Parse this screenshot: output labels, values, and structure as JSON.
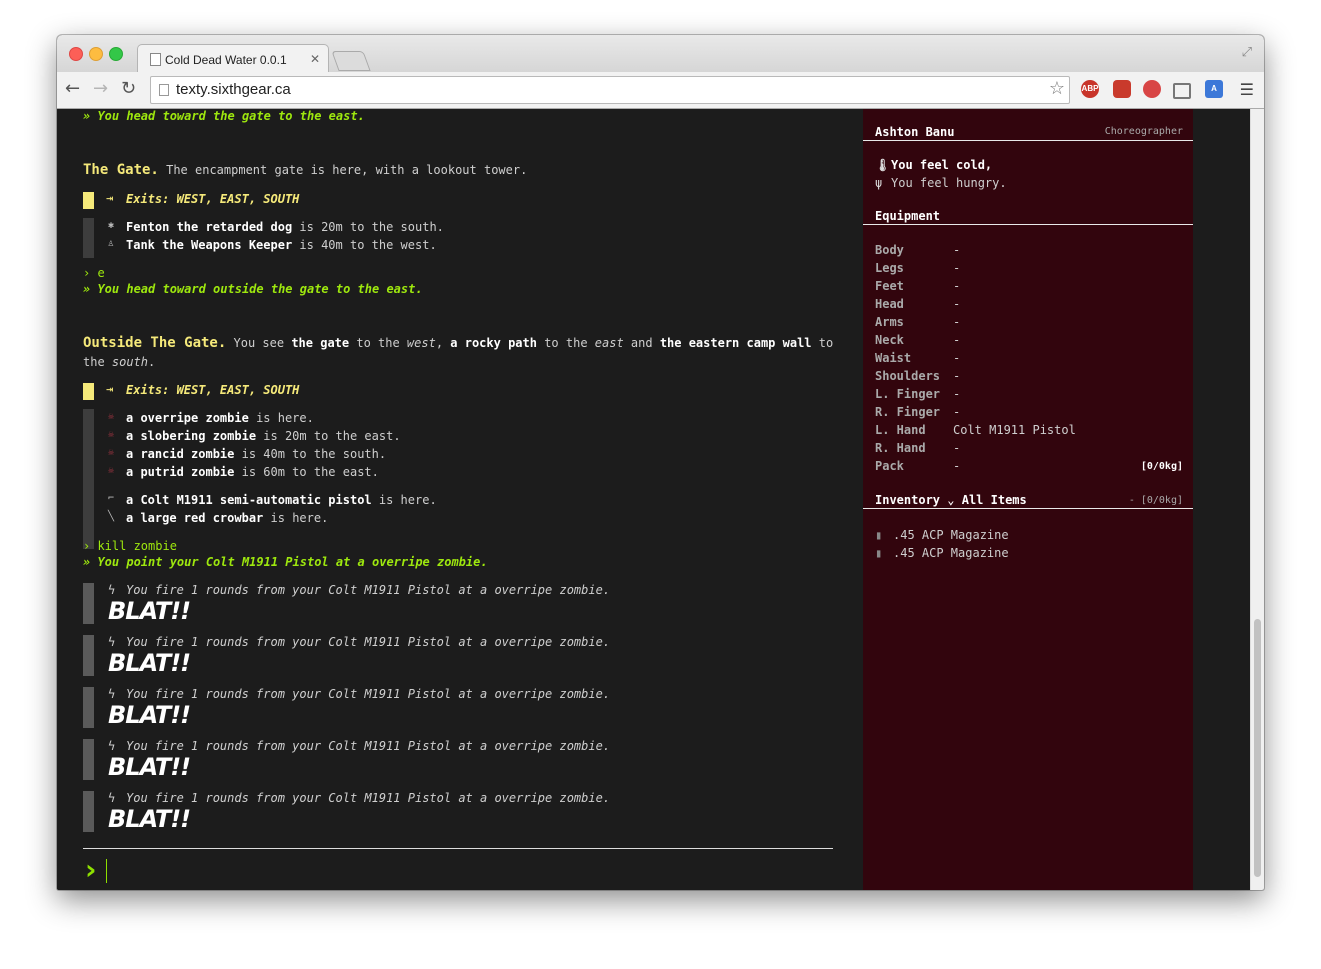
{
  "browser": {
    "tab_title": "Cold Dead Water 0.0.1",
    "url": "texty.sixthgear.ca",
    "ext_abp": "ABP"
  },
  "log": {
    "echo1": "You head toward the gate to the east.",
    "room1_name": "The Gate.",
    "room1_desc": "The encampment gate is here, with a lookout tower.",
    "room1_exits": "Exits: WEST, EAST, SOUTH",
    "room1_entities": [
      {
        "name": "Fenton the retarded dog",
        "rest": "is 20m to the south."
      },
      {
        "name": "Tank the Weapons Keeper",
        "rest": "is 40m to the west."
      }
    ],
    "cmd2": "e",
    "echo2": "You head toward outside the gate to the east.",
    "room2_name": "Outside The Gate.",
    "room2_desc": {
      "p1": "You see ",
      "b1": "the gate",
      "p2": " to the ",
      "i1": "west",
      "p3": ", ",
      "b2": "a rocky path",
      "p4": " to the ",
      "i2": "east",
      "p5": " and ",
      "b3": "the eastern camp wall",
      "p6": " to",
      "p7": "the ",
      "i3": "south",
      "p8": "."
    },
    "room2_exits": "Exits: WEST, EAST, SOUTH",
    "zombies": [
      {
        "name": "a overripe zombie",
        "rest": "is here."
      },
      {
        "name": "a slobering zombie",
        "rest": "is 20m to the east."
      },
      {
        "name": "a rancid zombie",
        "rest": "is 40m to the south."
      },
      {
        "name": "a putrid zombie",
        "rest": "is 60m to the east."
      }
    ],
    "items": [
      {
        "name": "a Colt M1911 semi-automatic pistol",
        "rest": "is here."
      },
      {
        "name": "a large red crowbar",
        "rest": "is here."
      }
    ],
    "cmd3": "kill zombie",
    "echo3": "You point your Colt M1911 Pistol at a overripe zombie.",
    "fire_text": "You fire 1 rounds from your Colt M1911 Pistol at a overripe zombie.",
    "blat": "BLAT!!"
  },
  "sidebar": {
    "character_name": "Ashton Banu",
    "character_class": "Choreographer",
    "status": [
      "You feel cold,",
      "You feel hungry."
    ],
    "equipment_title": "Equipment",
    "equipment": [
      {
        "slot": "Body",
        "value": "-"
      },
      {
        "slot": "Legs",
        "value": "-"
      },
      {
        "slot": "Feet",
        "value": "-"
      },
      {
        "slot": "Head",
        "value": "-"
      },
      {
        "slot": "Arms",
        "value": "-"
      },
      {
        "slot": "Neck",
        "value": "-"
      },
      {
        "slot": "Waist",
        "value": "-"
      },
      {
        "slot": "Shoulders",
        "value": "-"
      },
      {
        "slot": "L. Finger",
        "value": "-"
      },
      {
        "slot": "R. Finger",
        "value": "-"
      },
      {
        "slot": "L. Hand",
        "value": "Colt M1911 Pistol"
      },
      {
        "slot": "R. Hand",
        "value": "-"
      },
      {
        "slot": "Pack",
        "value": "-"
      }
    ],
    "pack_weight": "[0/0kg]",
    "inventory_title": "Inventory",
    "inventory_filter": "All Items",
    "inventory_weight": "- [0/0kg]",
    "inventory": [
      ".45 ACP Magazine",
      ".45 ACP Magazine"
    ]
  },
  "colors": {
    "accent_green": "#9ee80e",
    "room_yellow": "#f5e97a",
    "sidebar_bg": "#32050d",
    "zombie_red": "#a13542"
  }
}
